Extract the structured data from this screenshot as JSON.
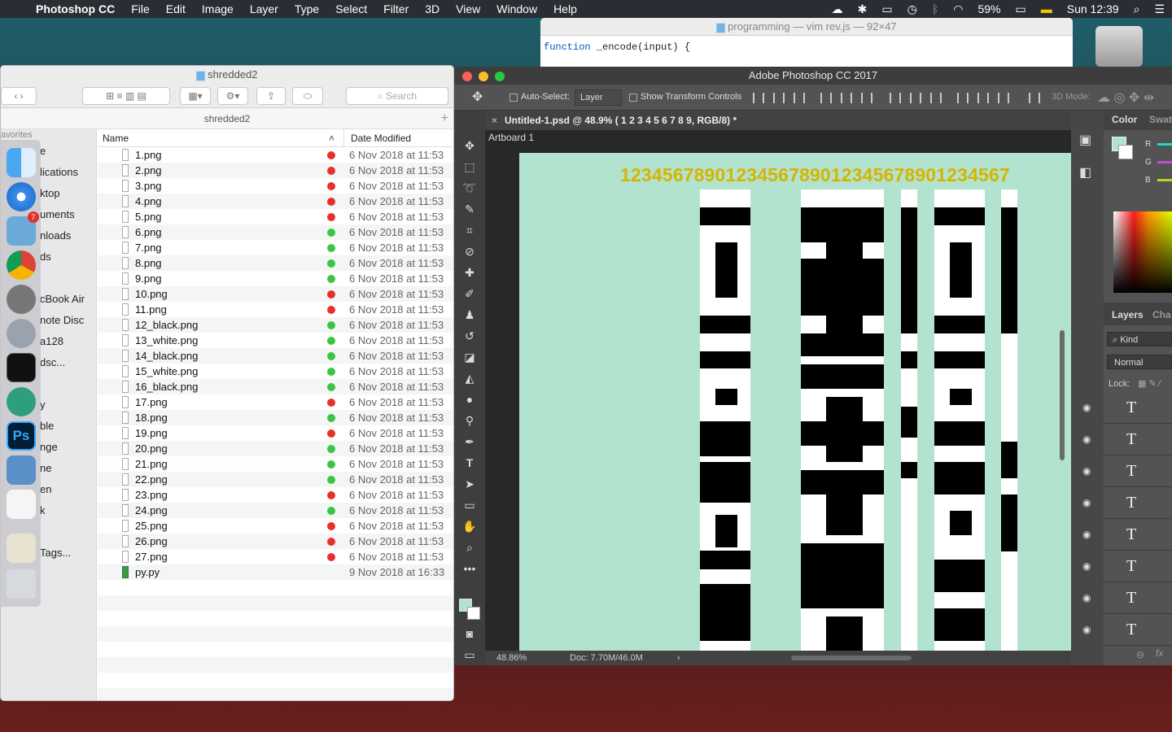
{
  "menubar": {
    "app": "Photoshop CC",
    "items": [
      "File",
      "Edit",
      "Image",
      "Layer",
      "Type",
      "Select",
      "Filter",
      "3D",
      "View",
      "Window",
      "Help"
    ],
    "battery": "59%",
    "clock": "Sun 12:39"
  },
  "vim": {
    "title": "programming — vim rev.js — 92×47",
    "code_keyword": "function",
    "code_rest": " _encode(input) {"
  },
  "finder": {
    "title": "shredded2",
    "search_placeholder": "Search",
    "path": "shredded2",
    "col_name": "Name",
    "col_date": "Date Modified",
    "sidebar": [
      "avorites",
      "e",
      "lications",
      "ktop",
      "uments",
      "nloads",
      "ds",
      "",
      "cBook Air",
      "note Disc",
      "a128",
      "dsc...",
      "",
      "y",
      "ble",
      "nge",
      "ne",
      "en",
      "k",
      "",
      "Tags..."
    ],
    "files": [
      {
        "name": "1.png",
        "tag": "#e8302a",
        "date": "6 Nov 2018 at 11:53"
      },
      {
        "name": "2.png",
        "tag": "#e8302a",
        "date": "6 Nov 2018 at 11:53"
      },
      {
        "name": "3.png",
        "tag": "#e8302a",
        "date": "6 Nov 2018 at 11:53"
      },
      {
        "name": "4.png",
        "tag": "#e8302a",
        "date": "6 Nov 2018 at 11:53"
      },
      {
        "name": "5.png",
        "tag": "#e8302a",
        "date": "6 Nov 2018 at 11:53"
      },
      {
        "name": "6.png",
        "tag": "#3cc44a",
        "date": "6 Nov 2018 at 11:53"
      },
      {
        "name": "7.png",
        "tag": "#3cc44a",
        "date": "6 Nov 2018 at 11:53"
      },
      {
        "name": "8.png",
        "tag": "#3cc44a",
        "date": "6 Nov 2018 at 11:53"
      },
      {
        "name": "9.png",
        "tag": "#3cc44a",
        "date": "6 Nov 2018 at 11:53"
      },
      {
        "name": "10.png",
        "tag": "#e8302a",
        "date": "6 Nov 2018 at 11:53"
      },
      {
        "name": "11.png",
        "tag": "#e8302a",
        "date": "6 Nov 2018 at 11:53"
      },
      {
        "name": "12_black.png",
        "tag": "#3cc44a",
        "date": "6 Nov 2018 at 11:53"
      },
      {
        "name": "13_white.png",
        "tag": "#3cc44a",
        "date": "6 Nov 2018 at 11:53"
      },
      {
        "name": "14_black.png",
        "tag": "#3cc44a",
        "date": "6 Nov 2018 at 11:53"
      },
      {
        "name": "15_white.png",
        "tag": "#3cc44a",
        "date": "6 Nov 2018 at 11:53"
      },
      {
        "name": "16_black.png",
        "tag": "#3cc44a",
        "date": "6 Nov 2018 at 11:53"
      },
      {
        "name": "17.png",
        "tag": "#e8302a",
        "date": "6 Nov 2018 at 11:53"
      },
      {
        "name": "18.png",
        "tag": "#3cc44a",
        "date": "6 Nov 2018 at 11:53"
      },
      {
        "name": "19.png",
        "tag": "#e8302a",
        "date": "6 Nov 2018 at 11:53"
      },
      {
        "name": "20.png",
        "tag": "#3cc44a",
        "date": "6 Nov 2018 at 11:53"
      },
      {
        "name": "21.png",
        "tag": "#3cc44a",
        "date": "6 Nov 2018 at 11:53"
      },
      {
        "name": "22.png",
        "tag": "#3cc44a",
        "date": "6 Nov 2018 at 11:53"
      },
      {
        "name": "23.png",
        "tag": "#e8302a",
        "date": "6 Nov 2018 at 11:53"
      },
      {
        "name": "24.png",
        "tag": "#3cc44a",
        "date": "6 Nov 2018 at 11:53"
      },
      {
        "name": "25.png",
        "tag": "#e8302a",
        "date": "6 Nov 2018 at 11:53"
      },
      {
        "name": "26.png",
        "tag": "#e8302a",
        "date": "6 Nov 2018 at 11:53"
      },
      {
        "name": "27.png",
        "tag": "#e8302a",
        "date": "6 Nov 2018 at 11:53"
      },
      {
        "name": "py.py",
        "tag": "",
        "date": "9 Nov 2018 at 16:33"
      }
    ]
  },
  "photoshop": {
    "title": "Adobe Photoshop CC 2017",
    "options": {
      "auto_select": "Auto-Select:",
      "layer": "Layer",
      "show_transform": "Show Transform Controls",
      "mode_3d": "3D Mode:"
    },
    "doc_tab": "Untitled-1.psd @ 48.9% (    1 2 3 4 5 6 7 8 9, RGB/8) *",
    "artboard": "Artboard 1",
    "ruler_digits": "1234567890123456789012345678901234567",
    "zoom": "48.86%",
    "doc_size": "Doc: 7.70M/46.0M",
    "panel": {
      "color_tab": "Color",
      "swatches_tab": "Swatc",
      "r": "R",
      "g": "G",
      "b": "B",
      "layers_tab": "Layers",
      "channels_tab": "Cha",
      "kind": "Kind",
      "blend": "Normal",
      "lock": "Lock:",
      "layer_glyph": "T"
    },
    "canvas_color": "#b2e3cf"
  }
}
